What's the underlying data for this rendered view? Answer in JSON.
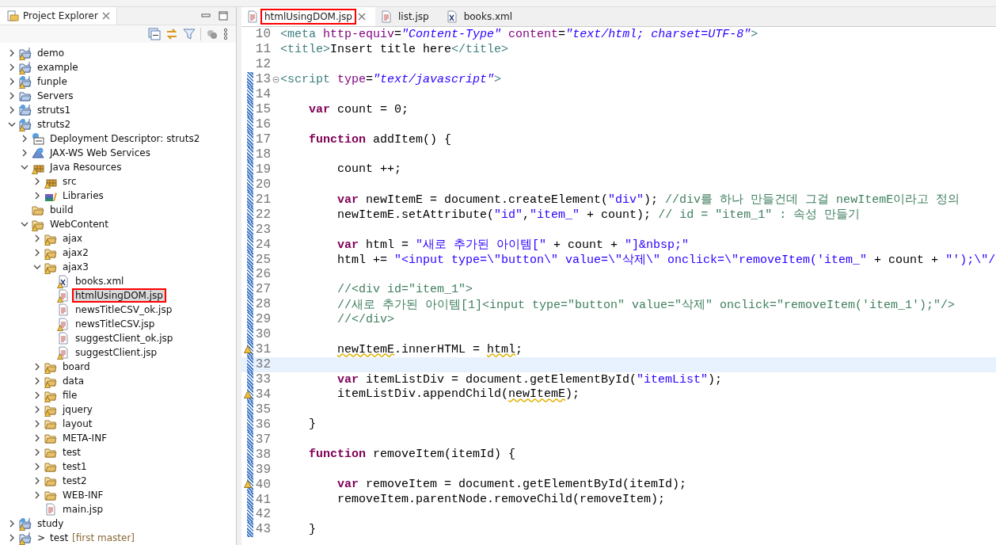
{
  "explorer": {
    "title": "Project Explorer",
    "tree": [
      {
        "label": "demo",
        "kind": "project",
        "warning": true,
        "leaf": false,
        "expanded": false,
        "selected": false,
        "highlighted": false
      },
      {
        "label": "example",
        "kind": "project",
        "warning": true,
        "leaf": false,
        "expanded": false,
        "selected": false,
        "highlighted": false
      },
      {
        "label": "funple",
        "kind": "web-project",
        "warning": true,
        "leaf": false,
        "expanded": false,
        "selected": false,
        "highlighted": false
      },
      {
        "label": "Servers",
        "kind": "plain-project",
        "warning": false,
        "leaf": false,
        "expanded": false,
        "selected": false,
        "highlighted": false
      },
      {
        "label": "struts1",
        "kind": "web-project",
        "warning": false,
        "leaf": false,
        "expanded": false,
        "selected": false,
        "highlighted": false
      },
      {
        "label": "struts2",
        "kind": "web-project",
        "warning": true,
        "leaf": false,
        "expanded": true,
        "selected": false,
        "highlighted": false,
        "children": [
          {
            "label": "Deployment Descriptor: struts2",
            "kind": "descriptor",
            "warning": false,
            "leaf": false,
            "expanded": false,
            "selected": false,
            "highlighted": false
          },
          {
            "label": "JAX-WS Web Services",
            "kind": "webservice",
            "warning": false,
            "leaf": false,
            "expanded": false,
            "selected": false,
            "highlighted": false
          },
          {
            "label": "Java Resources",
            "kind": "package",
            "warning": true,
            "leaf": false,
            "expanded": true,
            "selected": false,
            "highlighted": false,
            "children": [
              {
                "label": "src",
                "kind": "package",
                "warning": true,
                "leaf": false,
                "expanded": false,
                "selected": false,
                "highlighted": false
              },
              {
                "label": "Libraries",
                "kind": "libraries",
                "warning": false,
                "leaf": false,
                "expanded": false,
                "selected": false,
                "highlighted": false
              }
            ]
          },
          {
            "label": "build",
            "kind": "folder",
            "warning": false,
            "leaf": true,
            "expanded": false,
            "selected": false,
            "highlighted": false
          },
          {
            "label": "WebContent",
            "kind": "folder",
            "warning": true,
            "leaf": false,
            "expanded": true,
            "selected": false,
            "highlighted": false,
            "children": [
              {
                "label": "ajax",
                "kind": "folder",
                "warning": true,
                "leaf": false,
                "expanded": false,
                "selected": false,
                "highlighted": false
              },
              {
                "label": "ajax2",
                "kind": "folder",
                "warning": true,
                "leaf": false,
                "expanded": false,
                "selected": false,
                "highlighted": false
              },
              {
                "label": "ajax3",
                "kind": "folder",
                "warning": true,
                "leaf": false,
                "expanded": true,
                "selected": false,
                "highlighted": false,
                "children": [
                  {
                    "label": "books.xml",
                    "kind": "xml",
                    "warning": true,
                    "leaf": true,
                    "expanded": false,
                    "selected": false,
                    "highlighted": false
                  },
                  {
                    "label": "htmlUsingDOM.jsp",
                    "kind": "jsp",
                    "warning": true,
                    "leaf": true,
                    "expanded": false,
                    "selected": true,
                    "highlighted": true
                  },
                  {
                    "label": "newsTitleCSV_ok.jsp",
                    "kind": "jsp",
                    "warning": false,
                    "leaf": true,
                    "expanded": false,
                    "selected": false,
                    "highlighted": false
                  },
                  {
                    "label": "newsTitleCSV.jsp",
                    "kind": "jsp",
                    "warning": true,
                    "leaf": true,
                    "expanded": false,
                    "selected": false,
                    "highlighted": false
                  },
                  {
                    "label": "suggestClient_ok.jsp",
                    "kind": "jsp",
                    "warning": false,
                    "leaf": true,
                    "expanded": false,
                    "selected": false,
                    "highlighted": false
                  },
                  {
                    "label": "suggestClient.jsp",
                    "kind": "jsp",
                    "warning": true,
                    "leaf": true,
                    "expanded": false,
                    "selected": false,
                    "highlighted": false
                  }
                ]
              },
              {
                "label": "board",
                "kind": "folder",
                "warning": true,
                "leaf": false,
                "expanded": false,
                "selected": false,
                "highlighted": false
              },
              {
                "label": "data",
                "kind": "folder",
                "warning": true,
                "leaf": false,
                "expanded": false,
                "selected": false,
                "highlighted": false
              },
              {
                "label": "file",
                "kind": "folder",
                "warning": true,
                "leaf": false,
                "expanded": false,
                "selected": false,
                "highlighted": false
              },
              {
                "label": "jquery",
                "kind": "folder",
                "warning": true,
                "leaf": false,
                "expanded": false,
                "selected": false,
                "highlighted": false
              },
              {
                "label": "layout",
                "kind": "folder",
                "warning": false,
                "leaf": false,
                "expanded": false,
                "selected": false,
                "highlighted": false
              },
              {
                "label": "META-INF",
                "kind": "folder",
                "warning": false,
                "leaf": false,
                "expanded": false,
                "selected": false,
                "highlighted": false
              },
              {
                "label": "test",
                "kind": "folder",
                "warning": false,
                "leaf": false,
                "expanded": false,
                "selected": false,
                "highlighted": false
              },
              {
                "label": "test1",
                "kind": "folder",
                "warning": false,
                "leaf": false,
                "expanded": false,
                "selected": false,
                "highlighted": false
              },
              {
                "label": "test2",
                "kind": "folder",
                "warning": false,
                "leaf": false,
                "expanded": false,
                "selected": false,
                "highlighted": false
              },
              {
                "label": "WEB-INF",
                "kind": "folder",
                "warning": false,
                "leaf": false,
                "expanded": false,
                "selected": false,
                "highlighted": false
              },
              {
                "label": "main.jsp",
                "kind": "jsp",
                "warning": false,
                "leaf": true,
                "expanded": false,
                "selected": false,
                "highlighted": false
              }
            ]
          }
        ]
      },
      {
        "label": "study",
        "kind": "web-project",
        "warning": true,
        "leaf": false,
        "expanded": false,
        "selected": false,
        "highlighted": false
      },
      {
        "label": "test",
        "kind": "git-project",
        "warning": true,
        "prefix": ">",
        "decoration": "[first master]",
        "leaf": false,
        "expanded": false,
        "selected": false,
        "highlighted": false
      }
    ]
  },
  "editor": {
    "tabs": [
      {
        "label": "htmlUsingDOM.jsp",
        "kind": "jsp",
        "selected": true,
        "highlighted": true
      },
      {
        "label": "list.jsp",
        "kind": "jsp",
        "selected": false,
        "highlighted": false
      },
      {
        "label": "books.xml",
        "kind": "xml",
        "selected": false,
        "highlighted": false
      }
    ],
    "lines": [
      {
        "number": "10",
        "kind": "markup",
        "changed": false,
        "warning": false,
        "current": false,
        "fold": false,
        "tokens": [
          {
            "kind": "tag",
            "text": "<meta"
          },
          {
            "kind": "attr",
            "text": " http-equiv"
          },
          {
            "kind": "plain",
            "text": "="
          },
          {
            "kind": "value",
            "text": "\"Content-Type\""
          },
          {
            "kind": "attr",
            "text": " content"
          },
          {
            "kind": "plain",
            "text": "="
          },
          {
            "kind": "value",
            "text": "\"text/html; charset=UTF-8\""
          },
          {
            "kind": "tag",
            "text": ">"
          }
        ]
      },
      {
        "number": "11",
        "kind": "markup",
        "changed": false,
        "warning": false,
        "current": false,
        "fold": false,
        "tokens": [
          {
            "kind": "tag",
            "text": "<title>"
          },
          {
            "kind": "plain",
            "text": "Insert title here"
          },
          {
            "kind": "tag",
            "text": "</title>"
          }
        ]
      },
      {
        "number": "12",
        "changed": false,
        "warning": false,
        "current": false,
        "fold": false
      },
      {
        "number": "13",
        "kind": "markup",
        "changed": true,
        "warning": false,
        "current": false,
        "fold": true,
        "tokens": [
          {
            "kind": "tag",
            "text": "<script"
          },
          {
            "kind": "attr",
            "text": " type"
          },
          {
            "kind": "plain",
            "text": "="
          },
          {
            "kind": "value",
            "text": "\"text/javascript\""
          },
          {
            "kind": "tag",
            "text": ">"
          }
        ]
      },
      {
        "number": "14",
        "changed": true,
        "warning": false,
        "current": false,
        "fold": false
      },
      {
        "number": "15",
        "kind": "script",
        "changed": true,
        "warning": false,
        "current": false,
        "fold": false,
        "tokens": [
          {
            "kind": "keyword",
            "text": "var"
          },
          {
            "kind": "plain",
            "text": " count = 0;"
          }
        ]
      },
      {
        "number": "16",
        "changed": true,
        "warning": false,
        "current": false,
        "fold": false
      },
      {
        "number": "17",
        "kind": "script",
        "changed": true,
        "warning": false,
        "current": false,
        "fold": false,
        "tokens": [
          {
            "kind": "keyword",
            "text": "function"
          },
          {
            "kind": "plain",
            "text": " addItem() {"
          }
        ]
      },
      {
        "number": "18",
        "changed": true,
        "warning": false,
        "current": false,
        "fold": false
      },
      {
        "number": "19",
        "kind": "function",
        "changed": true,
        "warning": false,
        "current": false,
        "fold": false,
        "tokens": [
          {
            "kind": "plain",
            "text": "count ++;"
          }
        ]
      },
      {
        "number": "20",
        "changed": true,
        "warning": false,
        "current": false,
        "fold": false
      },
      {
        "number": "21",
        "kind": "function",
        "changed": true,
        "warning": false,
        "current": false,
        "fold": false,
        "tokens": [
          {
            "kind": "keyword",
            "text": "var"
          },
          {
            "kind": "plain",
            "text": " newItemE = document.createElement("
          },
          {
            "kind": "string",
            "text": "\"div\""
          },
          {
            "kind": "plain",
            "text": "); "
          },
          {
            "kind": "comment",
            "text": "//div를 하나 만들건데 그걸 newItemE이라고 정의"
          }
        ]
      },
      {
        "number": "22",
        "kind": "function",
        "changed": true,
        "warning": false,
        "current": false,
        "fold": false,
        "tokens": [
          {
            "kind": "plain",
            "text": "newItemE.setAttribute("
          },
          {
            "kind": "string",
            "text": "\"id\""
          },
          {
            "kind": "plain",
            "text": ","
          },
          {
            "kind": "string",
            "text": "\"item_\""
          },
          {
            "kind": "plain",
            "text": " + count); "
          },
          {
            "kind": "comment",
            "text": "// id = \"item_1\" : 속성 만들기"
          }
        ]
      },
      {
        "number": "23",
        "changed": true,
        "warning": false,
        "current": false,
        "fold": false
      },
      {
        "number": "24",
        "kind": "function",
        "changed": true,
        "warning": false,
        "current": false,
        "fold": false,
        "tokens": [
          {
            "kind": "keyword",
            "text": "var"
          },
          {
            "kind": "plain",
            "text": " html = "
          },
          {
            "kind": "string",
            "text": "\"새로 추가된 아이템[\""
          },
          {
            "kind": "plain",
            "text": " + count + "
          },
          {
            "kind": "string",
            "text": "\"]&nbsp;\""
          }
        ]
      },
      {
        "number": "25",
        "kind": "function",
        "changed": true,
        "warning": false,
        "current": false,
        "fold": false,
        "tokens": [
          {
            "kind": "plain",
            "text": "html += "
          },
          {
            "kind": "string",
            "text": "\"<input type=\\\"button\\\" value=\\\"삭제\\\" onclick=\\\"removeItem('item_\""
          },
          {
            "kind": "plain",
            "text": " + count + "
          },
          {
            "kind": "string",
            "text": "\"');\\\"/"
          }
        ]
      },
      {
        "number": "26",
        "changed": true,
        "warning": false,
        "current": false,
        "fold": false
      },
      {
        "number": "27",
        "kind": "function",
        "changed": true,
        "warning": false,
        "current": false,
        "fold": false,
        "tokens": [
          {
            "kind": "comment",
            "text": "//<div id=\"item_1\">"
          }
        ]
      },
      {
        "number": "28",
        "kind": "function",
        "changed": true,
        "warning": false,
        "current": false,
        "fold": false,
        "tokens": [
          {
            "kind": "comment",
            "text": "//새로 추가된 아이템[1]<input type=\"button\" value=\"삭제\" onclick=\"removeItem('item_1');\"/>"
          }
        ]
      },
      {
        "number": "29",
        "kind": "function",
        "changed": true,
        "warning": false,
        "current": false,
        "fold": false,
        "tokens": [
          {
            "kind": "comment",
            "text": "//</div>"
          }
        ]
      },
      {
        "number": "30",
        "changed": true,
        "warning": false,
        "current": false,
        "fold": false
      },
      {
        "number": "31",
        "kind": "function",
        "changed": true,
        "warning": true,
        "current": false,
        "fold": false,
        "tokens": [
          {
            "kind": "flagged",
            "text": "newItemE"
          },
          {
            "kind": "plain",
            "text": ".innerHTML = "
          },
          {
            "kind": "flagged",
            "text": "html"
          },
          {
            "kind": "plain",
            "text": ";"
          }
        ]
      },
      {
        "number": "32",
        "changed": true,
        "warning": false,
        "current": true,
        "fold": false
      },
      {
        "number": "33",
        "kind": "function",
        "changed": true,
        "warning": false,
        "current": false,
        "fold": false,
        "tokens": [
          {
            "kind": "keyword",
            "text": "var"
          },
          {
            "kind": "plain",
            "text": " itemListDiv = document.getElementById("
          },
          {
            "kind": "string",
            "text": "\"itemList\""
          },
          {
            "kind": "plain",
            "text": ");"
          }
        ]
      },
      {
        "number": "34",
        "kind": "function",
        "changed": true,
        "warning": true,
        "current": false,
        "fold": false,
        "tokens": [
          {
            "kind": "plain",
            "text": "itemListDiv.appendChild("
          },
          {
            "kind": "flagged",
            "text": "newItemE"
          },
          {
            "kind": "plain",
            "text": ");"
          }
        ]
      },
      {
        "number": "35",
        "changed": true,
        "warning": false,
        "current": false,
        "fold": false
      },
      {
        "number": "36",
        "kind": "script",
        "changed": true,
        "warning": false,
        "current": false,
        "fold": false,
        "tokens": [
          {
            "kind": "plain",
            "text": "}"
          }
        ]
      },
      {
        "number": "37",
        "changed": true,
        "warning": false,
        "current": false,
        "fold": false
      },
      {
        "number": "38",
        "kind": "script",
        "changed": true,
        "warning": false,
        "current": false,
        "fold": false,
        "tokens": [
          {
            "kind": "keyword",
            "text": "function"
          },
          {
            "kind": "plain",
            "text": " removeItem(itemId) {"
          }
        ]
      },
      {
        "number": "39",
        "changed": true,
        "warning": false,
        "current": false,
        "fold": false
      },
      {
        "number": "40",
        "kind": "function",
        "changed": true,
        "warning": true,
        "current": false,
        "fold": false,
        "tokens": [
          {
            "kind": "keyword",
            "text": "var"
          },
          {
            "kind": "plain",
            "text": " removeItem = document.getElementById(itemId);"
          }
        ]
      },
      {
        "number": "41",
        "kind": "function",
        "changed": true,
        "warning": false,
        "current": false,
        "fold": false,
        "tokens": [
          {
            "kind": "plain",
            "text": "removeItem.parentNode.removeChild(removeItem);"
          }
        ]
      },
      {
        "number": "42",
        "changed": true,
        "warning": false,
        "current": false,
        "fold": false
      },
      {
        "number": "43",
        "kind": "script",
        "changed": true,
        "warning": false,
        "current": false,
        "fold": false,
        "tokens": [
          {
            "kind": "plain",
            "text": "}"
          }
        ]
      }
    ]
  }
}
